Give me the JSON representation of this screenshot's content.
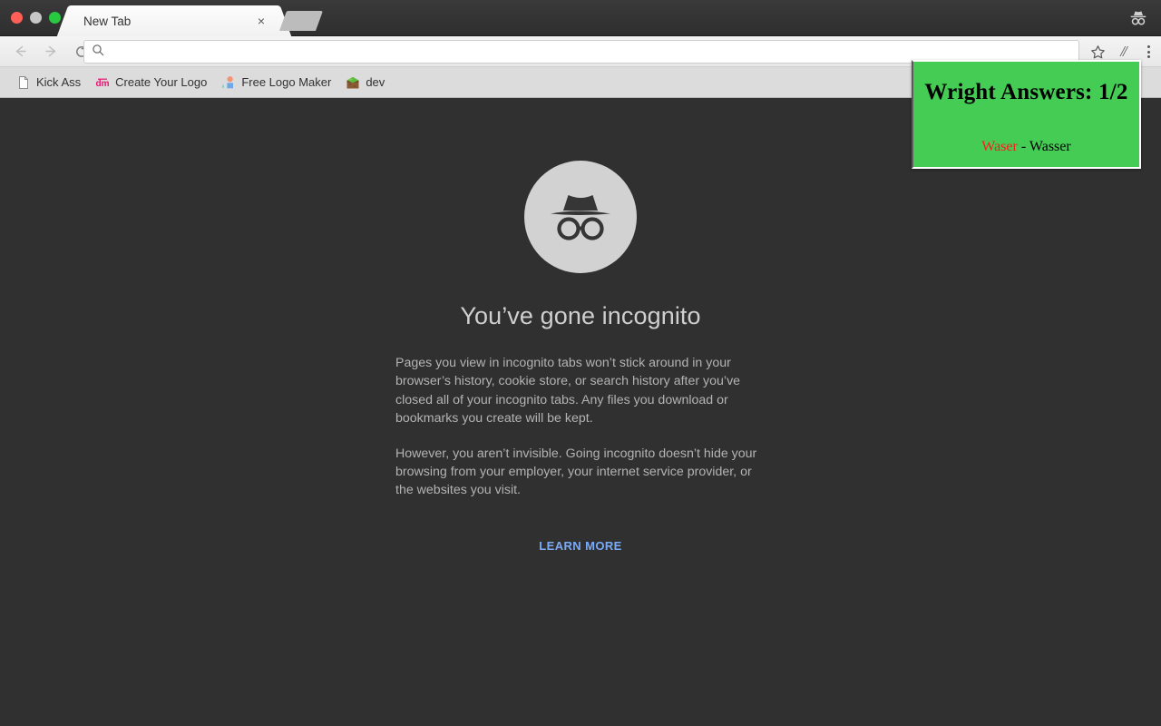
{
  "window": {
    "traffic_lights": [
      "close",
      "minimize",
      "zoom"
    ],
    "incognito_indicator_icon": "incognito-hat-icon"
  },
  "tabs": [
    {
      "title": "New Tab",
      "close_label": "×"
    }
  ],
  "newtab_button": {
    "label": ""
  },
  "toolbar": {
    "back_icon": "arrow-left-icon",
    "forward_icon": "arrow-right-icon",
    "reload_icon": "reload-icon",
    "search_icon": "search-icon",
    "bookmark_star_icon": "star-icon",
    "extension_icon": "slashes-extension-icon",
    "menu_icon": "three-dot-menu-icon"
  },
  "omnibox": {
    "value": "",
    "placeholder": ""
  },
  "bookmarks": [
    {
      "label": "Kick Ass",
      "icon": "page-icon"
    },
    {
      "label": "Create Your Logo",
      "icon": "dm-logo-icon"
    },
    {
      "label": "Free Logo Maker",
      "icon": "shapes-icon"
    },
    {
      "label": "dev",
      "icon": "minecraft-block-icon"
    }
  ],
  "page": {
    "icon": "incognito-spy-icon",
    "headline": "You’ve gone incognito",
    "paragraphs": [
      "Pages you view in incognito tabs won’t stick around in your browser’s history, cookie store, or search history after you’ve closed all of your incognito tabs. Any files you download or bookmarks you create will be kept.",
      "However, you aren’t invisible. Going incognito doesn’t hide your browsing from your employer, your internet service provider, or the websites you visit."
    ],
    "learn_more": "LEARN MORE",
    "background_color": "#303030",
    "link_color": "#7baaf7"
  },
  "popup": {
    "title": "Wright Answers: 1/2",
    "answer_wrong": "Waser",
    "answer_separator": " - ",
    "answer_correct": "Wasser",
    "background_color": "#44cc55",
    "wrong_color": "#ff1a1a"
  }
}
